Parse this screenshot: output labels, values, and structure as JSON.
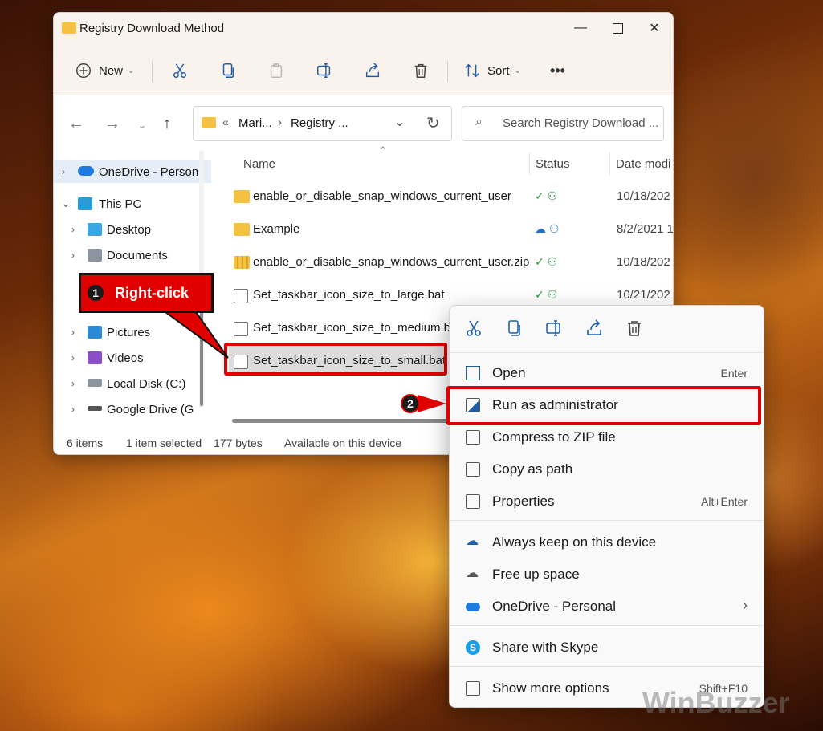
{
  "window": {
    "title": "Registry Download Method"
  },
  "toolbar": {
    "new_label": "New",
    "sort_label": "Sort",
    "more_label": "•••"
  },
  "address": {
    "prefix": "«",
    "crumb1": "Mari...",
    "sep": "›",
    "crumb2": "Registry ...",
    "search_placeholder": "Search Registry Download ..."
  },
  "nav": {
    "items": [
      {
        "label": "OneDrive - Person"
      },
      {
        "label": "This PC"
      },
      {
        "label": "Desktop"
      },
      {
        "label": "Documents"
      },
      {
        "label": "Pictures"
      },
      {
        "label": "Videos"
      },
      {
        "label": "Local Disk (C:)"
      },
      {
        "label": "Google Drive (G"
      }
    ]
  },
  "columns": {
    "name": "Name",
    "status": "Status",
    "date": "Date modi"
  },
  "files": [
    {
      "name": "enable_or_disable_snap_windows_current_user",
      "date": "10/18/202",
      "status": "synced"
    },
    {
      "name": "Example",
      "date": "8/2/2021 1",
      "status": "cloud"
    },
    {
      "name": "enable_or_disable_snap_windows_current_user.zip",
      "date": "10/18/202",
      "status": "synced"
    },
    {
      "name": "Set_taskbar_icon_size_to_large.bat",
      "date": "10/21/202",
      "status": "synced"
    },
    {
      "name": "Set_taskbar_icon_size_to_medium.bat",
      "date": "",
      "status": ""
    },
    {
      "name": "Set_taskbar_icon_size_to_small.bat",
      "date": "",
      "status": ""
    }
  ],
  "statusbar": {
    "count": "6 items",
    "selected": "1 item selected",
    "size": "177 bytes",
    "availability": "Available on this device"
  },
  "context_menu": {
    "items": [
      {
        "label": "Open",
        "shortcut": "Enter"
      },
      {
        "label": "Run as administrator",
        "shortcut": ""
      },
      {
        "label": "Compress to ZIP file",
        "shortcut": ""
      },
      {
        "label": "Copy as path",
        "shortcut": ""
      },
      {
        "label": "Properties",
        "shortcut": "Alt+Enter"
      },
      {
        "label": "Always keep on this device",
        "shortcut": ""
      },
      {
        "label": "Free up space",
        "shortcut": ""
      },
      {
        "label": "OneDrive - Personal",
        "shortcut": "›"
      },
      {
        "label": "Share with Skype",
        "shortcut": ""
      },
      {
        "label": "Show more options",
        "shortcut": "Shift+F10"
      }
    ]
  },
  "annotations": {
    "step1_number": "1",
    "step1_label": "Right-click",
    "step2_number": "2"
  },
  "watermark": "WinBuzzer",
  "colors": {
    "highlight": "#e00000",
    "folder": "#f5c141",
    "accent": "#1f5fa8"
  }
}
